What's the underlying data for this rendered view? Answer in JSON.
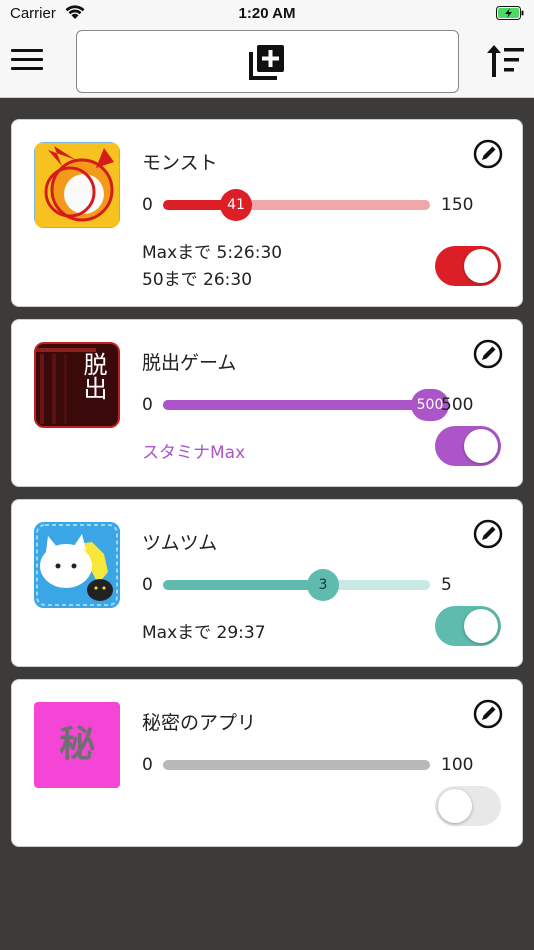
{
  "status_bar": {
    "carrier": "Carrier",
    "time": "1:20 AM"
  },
  "toolbar": {
    "menu_icon": "hamburger-icon",
    "add_icon": "add-to-library-icon",
    "sort_icon": "sort-icon"
  },
  "colors": {
    "background": "#3d3a3a",
    "red": "#dc1f26",
    "red_track": "#efa7a9",
    "purple": "#ab55c8",
    "purple_track": "#ab55c8",
    "teal": "#5fbbad",
    "teal_track": "#c8e8e3",
    "gray_track": "#b8b8b8",
    "toggle_off": "#e8e8e8"
  },
  "apps": [
    {
      "name": "モンスト",
      "min": "0",
      "max": "150",
      "value": "41",
      "value_fraction": 0.2733,
      "info": [
        "Maxまで 5:26:30",
        "50まで 26:30"
      ],
      "toggle_on": true,
      "icon": "monster-strike-icon"
    },
    {
      "name": "脱出ゲーム",
      "min": "0",
      "max": "500",
      "value": "500",
      "value_fraction": 1.0,
      "info": [
        "スタミナMax"
      ],
      "toggle_on": true,
      "icon": "escape-game-icon",
      "icon_text": "脱出"
    },
    {
      "name": "ツムツム",
      "min": "0",
      "max": "5",
      "value": "3",
      "value_fraction": 0.6,
      "info": [
        "Maxまで 29:37"
      ],
      "toggle_on": true,
      "icon": "tsum-tsum-icon"
    },
    {
      "name": "秘密のアプリ",
      "min": "0",
      "max": "100",
      "value_fraction": 0.0,
      "info": [],
      "toggle_on": false,
      "icon": "secret-app-icon",
      "icon_text": "秘"
    }
  ]
}
